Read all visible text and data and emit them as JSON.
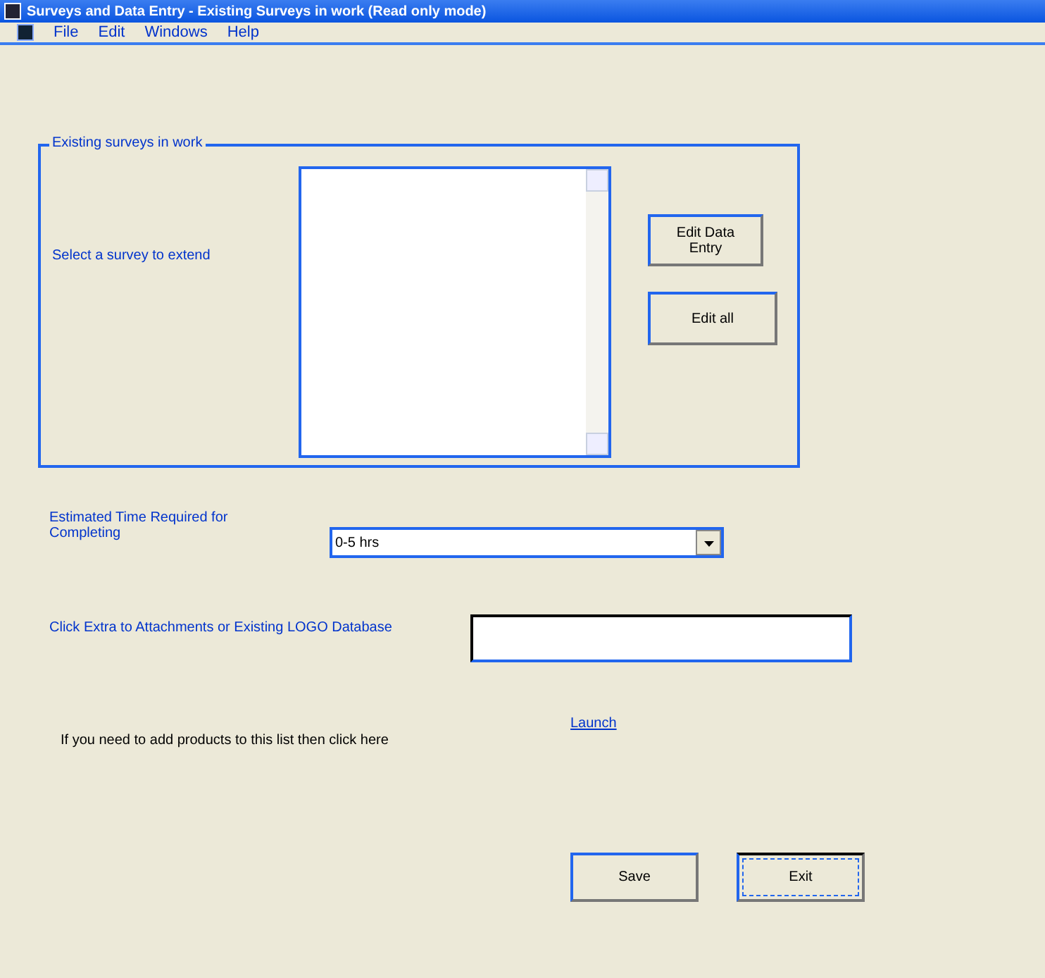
{
  "window": {
    "title": "Surveys and Data Entry - Existing Surveys in work (Read only mode)"
  },
  "menu": [
    "File",
    "Edit",
    "Windows",
    "Help"
  ],
  "group": {
    "title": "Existing surveys in work",
    "label": "Select a survey to extend",
    "buttons": [
      "Edit Data Entry",
      "Edit all"
    ]
  },
  "estimate": {
    "label": "Estimated Time Required for Completing",
    "value": "0-5 hrs"
  },
  "extra": {
    "label": "Click Extra to Attachments or Existing LOGO Database"
  },
  "products": {
    "text": "If you need to add products to this list then click here",
    "link": "Launch"
  },
  "buttons": [
    {
      "label": "Save",
      "focused": false
    },
    {
      "label": "Exit",
      "focused": true
    }
  ]
}
